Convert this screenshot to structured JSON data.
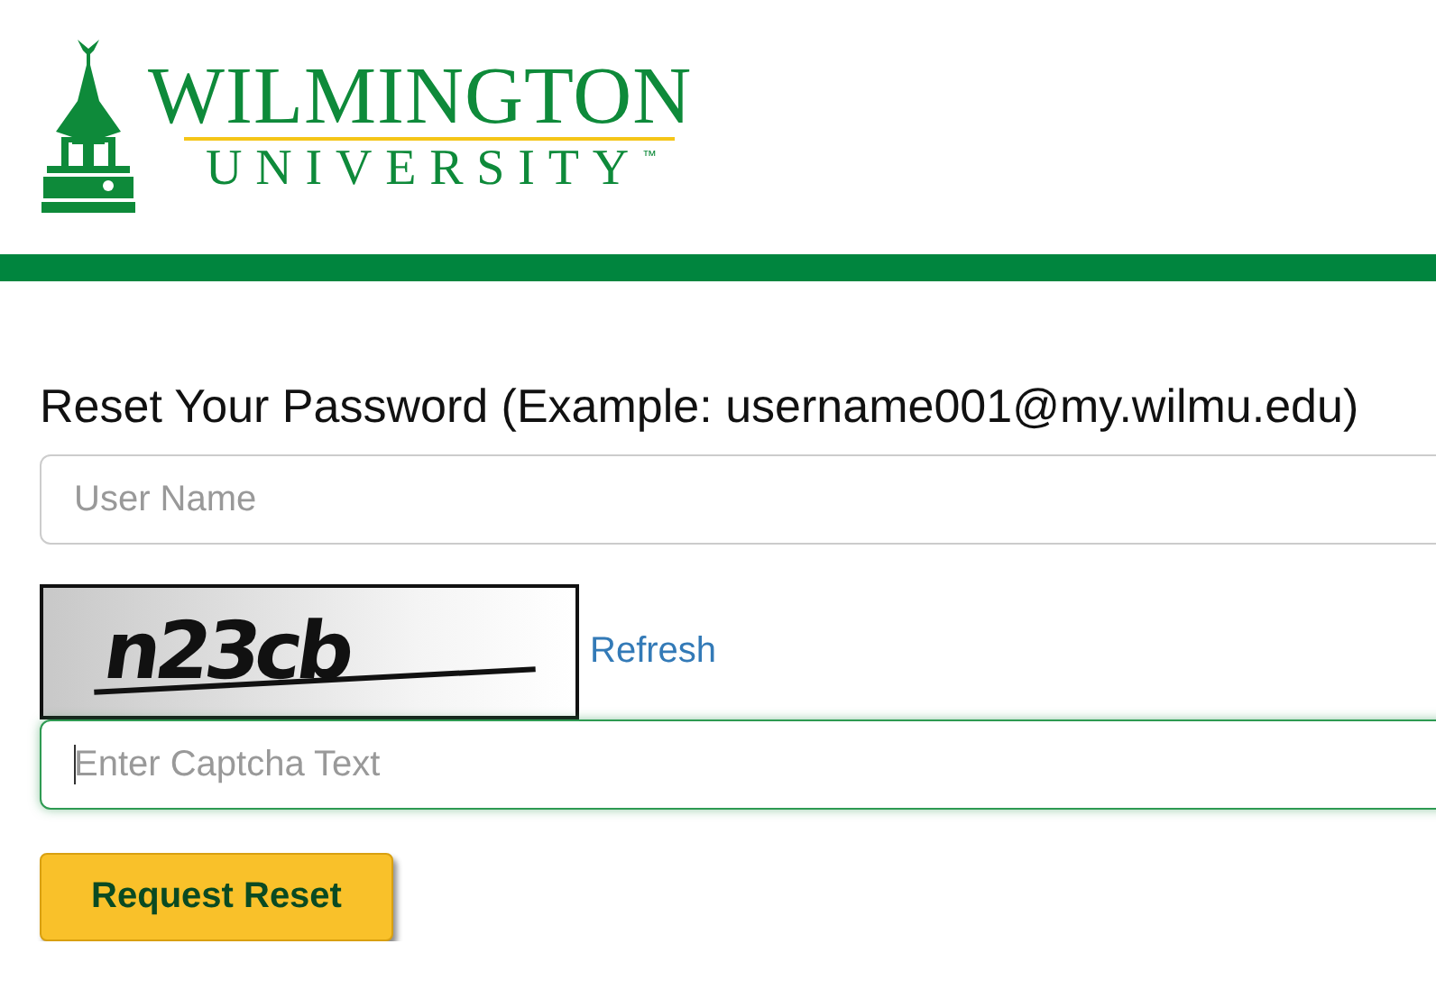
{
  "logo": {
    "name": "WILMINGTON",
    "subtitle": "UNIVERSITY",
    "trademark": "™"
  },
  "form": {
    "heading": "Reset Your Password (Example: username001@my.wilmu.edu)",
    "fields": [
      {
        "kind": "text",
        "placeholder": "User Name",
        "focused": false
      },
      {
        "kind": "captcha",
        "captcha_text": "n23cb",
        "refresh_link": "Refresh"
      },
      {
        "kind": "text",
        "placeholder": "Enter Captcha Text",
        "focused": true
      }
    ],
    "submit_button": "Request Reset"
  }
}
